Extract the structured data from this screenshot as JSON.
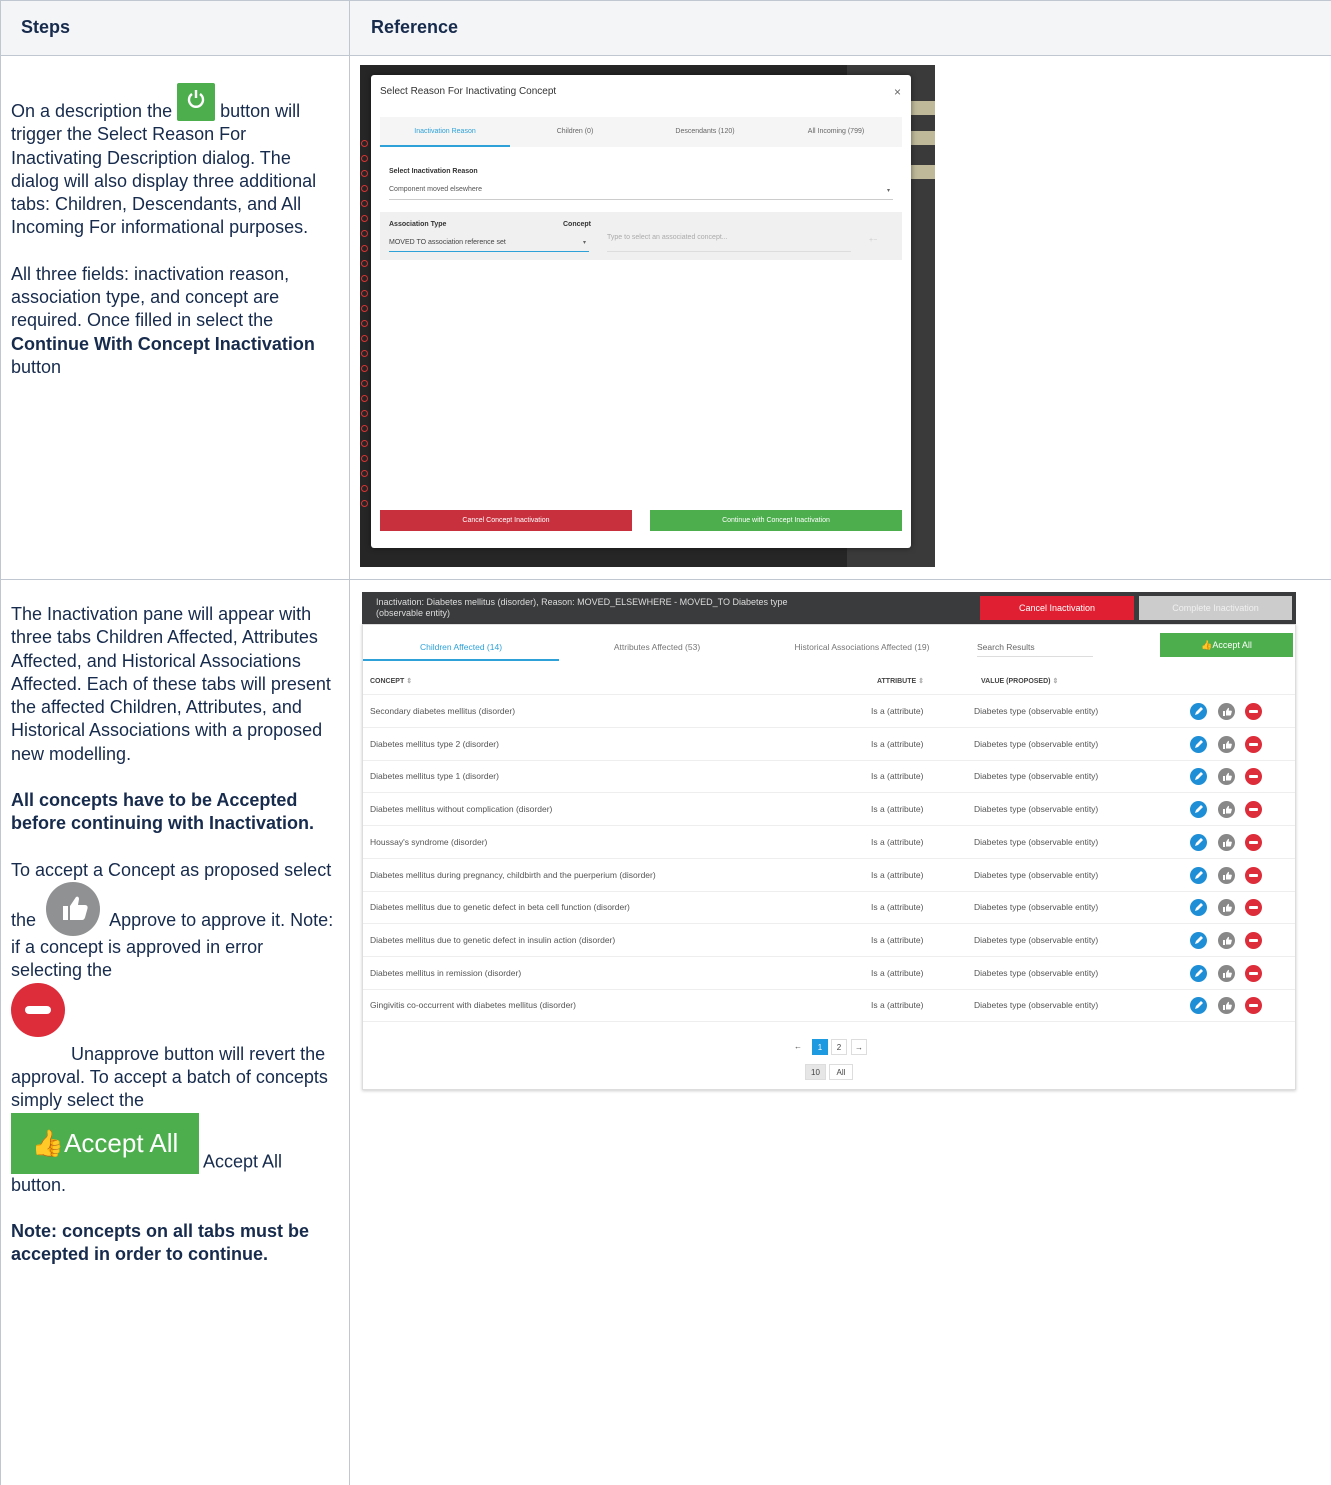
{
  "table": {
    "headers": [
      "Steps",
      "Reference"
    ],
    "row1": {
      "steps_p1_before": "On a description the",
      "steps_p1_after": "button will trigger the Select Reason For Inactivating Description dialog. The dialog will also display three additional tabs: Children, Descendants, and All Incoming For informational purposes.",
      "steps_p2_before": "All three fields: inactivation reason, association type, and concept are required. Once filled in select the",
      "steps_p2_bold": "Continue With Concept Inactivation",
      "steps_p2_after": "button"
    },
    "row2": {
      "steps_p1": "The Inactivation pane will appear with three tabs Children Affected, Attributes Affected, and Historical Associations Affected. Each of these tabs will present the affected Children, Attributes, and Historical Associations with a proposed new modelling.",
      "steps_p2_bold": "All concepts have to be Accepted before continuing with Inactivation.",
      "steps_p3_a": "To accept a Concept as proposed select the",
      "steps_p3_b": "Approve to approve it. Note: if a concept is approved in error selecting the",
      "steps_p3_c": "Unapprove button will revert the approval. To accept a batch of concepts simply select the",
      "steps_p3_d": "Accept All button.",
      "inline_accept_label": "Accept All",
      "steps_p4_bold": "Note: concepts on all tabs must be accepted in order to continue."
    }
  },
  "dialog": {
    "title": "Select Reason For Inactivating Concept",
    "close": "×",
    "tabs": [
      "Inactivation Reason",
      "Children (0)",
      "Descendants (120)",
      "All Incoming (799)"
    ],
    "reason_label": "Select Inactivation Reason",
    "reason_value": "Component moved elsewhere",
    "assoc_label": "Association Type",
    "concept_label": "Concept",
    "assoc_value": "MOVED TO association reference set",
    "concept_placeholder": "Type to select an associated concept...",
    "cancel_btn": "Cancel Concept Inactivation",
    "continue_btn": "Continue with Concept Inactivation"
  },
  "pane": {
    "title": "Inactivation: Diabetes mellitus (disorder), Reason: MOVED_ELSEWHERE - MOVED_TO Diabetes type (observable entity)",
    "cancel_btn": "Cancel Inactivation",
    "complete_btn": "Complete Inactivation",
    "tabs": [
      "Children Affected (14)",
      "Attributes Affected (53)",
      "Historical Associations Affected (19)"
    ],
    "search_placeholder": "Search Results",
    "accept_all": "Accept All",
    "columns": [
      "CONCEPT",
      "ATTRIBUTE",
      "VALUE (PROPOSED)"
    ],
    "rows": [
      {
        "concept": "Secondary diabetes mellitus (disorder)",
        "attribute": "Is a (attribute)",
        "value": "Diabetes type (observable entity)"
      },
      {
        "concept": "Diabetes mellitus type 2 (disorder)",
        "attribute": "Is a (attribute)",
        "value": "Diabetes type (observable entity)"
      },
      {
        "concept": "Diabetes mellitus type 1 (disorder)",
        "attribute": "Is a (attribute)",
        "value": "Diabetes type (observable entity)"
      },
      {
        "concept": "Diabetes mellitus without complication (disorder)",
        "attribute": "Is a (attribute)",
        "value": "Diabetes type (observable entity)"
      },
      {
        "concept": "Houssay's syndrome (disorder)",
        "attribute": "Is a (attribute)",
        "value": "Diabetes type (observable entity)"
      },
      {
        "concept": "Diabetes mellitus during pregnancy, childbirth and the puerperium (disorder)",
        "attribute": "Is a (attribute)",
        "value": "Diabetes type (observable entity)"
      },
      {
        "concept": "Diabetes mellitus due to genetic defect in beta cell function (disorder)",
        "attribute": "Is a (attribute)",
        "value": "Diabetes type (observable entity)"
      },
      {
        "concept": "Diabetes mellitus due to genetic defect in insulin action (disorder)",
        "attribute": "Is a (attribute)",
        "value": "Diabetes type (observable entity)"
      },
      {
        "concept": "Diabetes mellitus in remission (disorder)",
        "attribute": "Is a (attribute)",
        "value": "Diabetes type (observable entity)"
      },
      {
        "concept": "Gingivitis co-occurrent with diabetes mellitus (disorder)",
        "attribute": "Is a (attribute)",
        "value": "Diabetes type (observable entity)"
      }
    ],
    "pager": {
      "prev": "←",
      "pages": [
        "1",
        "2"
      ],
      "next": "→",
      "sizes": [
        "10",
        "All"
      ]
    }
  }
}
